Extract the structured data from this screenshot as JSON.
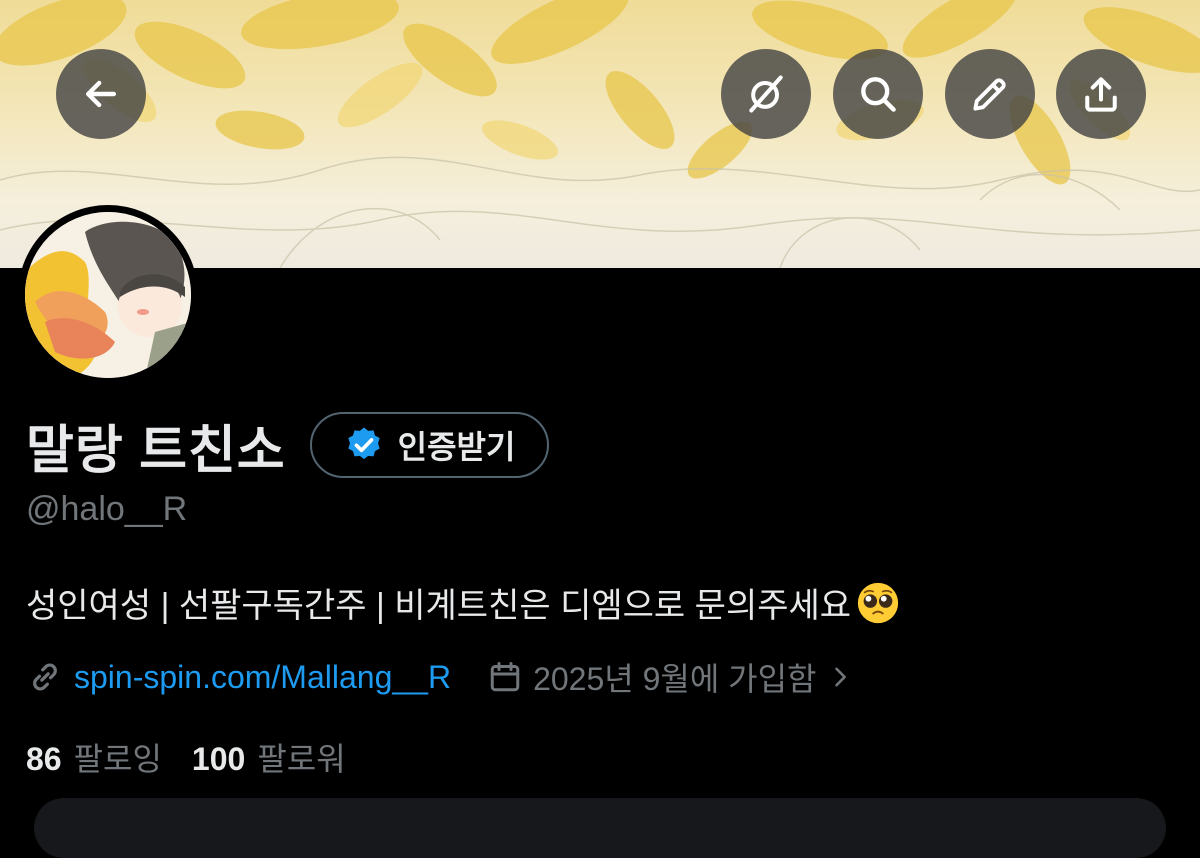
{
  "profile": {
    "display_name": "말랑 트친소",
    "verify_label": "인증받기",
    "handle": "@halo__R",
    "bio": "성인여성 | 선팔구독간주 | 비계트친은 디엠으로 문의주세요",
    "bio_emoji": "pleading-face-emoji",
    "link_text": "spin-spin.com/Mallang__R",
    "joined_text": "2025년 9월에 가입함",
    "following_count": "86",
    "following_label": "팔로잉",
    "followers_count": "100",
    "followers_label": "팔로워"
  },
  "header_buttons": [
    {
      "name": "back-button",
      "icon": "arrow-left-icon"
    },
    {
      "name": "grok-button",
      "icon": "grok-icon"
    },
    {
      "name": "search-button",
      "icon": "search-icon"
    },
    {
      "name": "edit-button",
      "icon": "pencil-icon"
    },
    {
      "name": "share-button",
      "icon": "share-icon"
    }
  ],
  "colors": {
    "accent": "#1d9bf0",
    "background": "#000000",
    "text_primary": "#e7e9ea",
    "text_secondary": "#71767b",
    "border": "#536471"
  }
}
